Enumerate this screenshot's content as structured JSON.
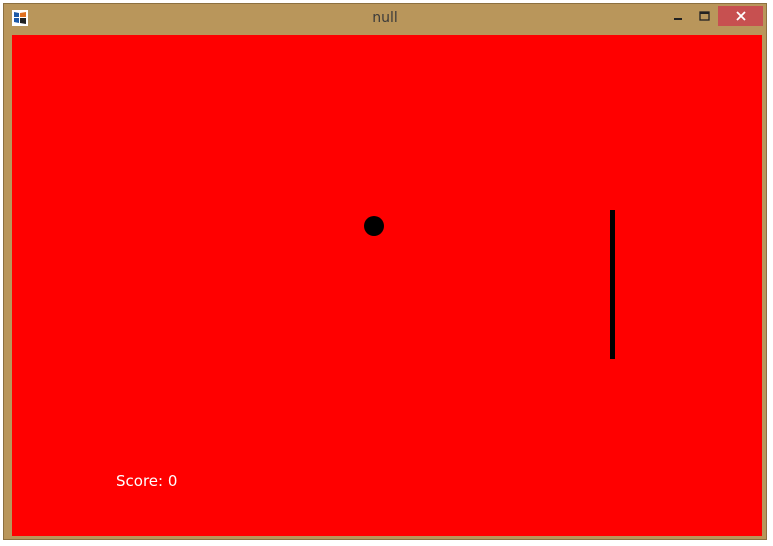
{
  "window": {
    "title": "null",
    "icons": {
      "app": "java-app-icon",
      "minimize": "minimize-icon",
      "maximize": "maximize-icon",
      "close": "close-icon"
    },
    "colors": {
      "frame": "#b9965b",
      "close_button": "#c75050"
    }
  },
  "game": {
    "background_color": "#ff0000",
    "ball_color": "#000000",
    "paddle_color": "#000000",
    "score": {
      "label": "Score:",
      "value": "0"
    }
  }
}
